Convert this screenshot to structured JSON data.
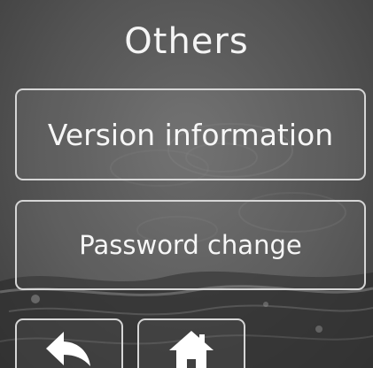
{
  "screen": {
    "title": "Others"
  },
  "menu": {
    "version_label": "Version information",
    "password_label": "Password change"
  },
  "nav": {
    "back_icon": "back-arrow-icon",
    "home_icon": "home-icon"
  },
  "colors": {
    "background": "#555555",
    "border": "#d6d6d6",
    "text": "#f4f4f4"
  }
}
